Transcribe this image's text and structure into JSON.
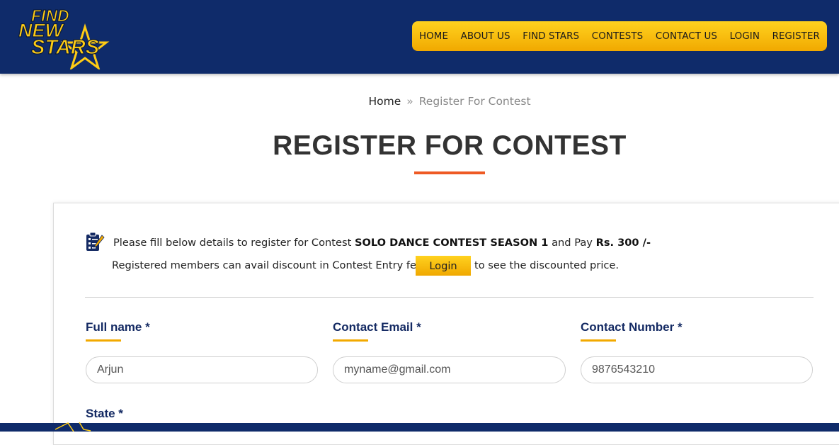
{
  "brand": {
    "logo_line1": "FIND",
    "logo_line2": "NEW",
    "logo_line3": "STARS",
    "colors": {
      "navy": "#0f2b6a",
      "yellow": "#ffcc14",
      "accent": "#ee5a24"
    }
  },
  "nav": {
    "items": [
      "HOME",
      "ABOUT US",
      "FIND STARS",
      "CONTESTS",
      "CONTACT US",
      "LOGIN",
      "REGISTER"
    ]
  },
  "breadcrumb": {
    "home": "Home",
    "separator": "»",
    "current": "Register For Contest"
  },
  "page": {
    "title": "REGISTER FOR CONTEST"
  },
  "notice": {
    "icon": "clipboard-edit-icon",
    "line1_prefix": "Please fill below details to register for Contest ",
    "contest_name": "SOLO DANCE CONTEST SEASON 1",
    "line1_middle": " and Pay ",
    "price": "Rs. 300 /-",
    "line2_prefix": "Registered members can avail discount in Contest Entry fees.",
    "login_label": "Login",
    "line2_suffix": "to see the discounted price."
  },
  "form": {
    "full_name": {
      "label": "Full name *",
      "value": "",
      "placeholder": "Arjun"
    },
    "email": {
      "label": "Contact Email *",
      "value": "",
      "placeholder": "myname@gmail.com"
    },
    "phone": {
      "label": "Contact Number *",
      "value": "",
      "placeholder": "9876543210"
    },
    "state": {
      "label": "State *"
    }
  }
}
